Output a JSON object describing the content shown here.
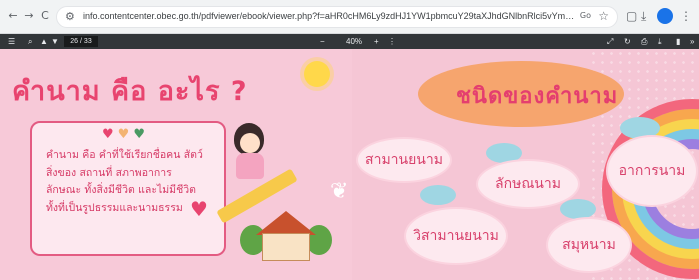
{
  "browser": {
    "back": "←",
    "forward": "→",
    "reload": "C",
    "url": "info.contentcenter.obec.go.th/pdfviewer/ebook/viewer.php?f=aHR0cHM6Ly9zdHJ1YW1pbmcuY29taXJhdGNlbnRlci5vYmVjLmdvLnRoL2NjLWFwaS9hcGkvdjEvc3RyZWFtaW5nL3AvTD...",
    "ext_label": "Go",
    "star": "☆"
  },
  "pdf_toolbar": {
    "menu_icon": "☰",
    "page_current": "26",
    "page_total": "/ 33",
    "zoom_minus": "−",
    "zoom_value": "40%",
    "zoom_plus": "+",
    "more": "⋮"
  },
  "left_page": {
    "title": "คำนาม คือ อะไร ?",
    "hearts": "♥♥♥",
    "text_lines": [
      "คำนาม คือ คำที่ใช้เรียกชื่อคน สัตว์",
      "สิ่งของ สถานที่ สภาพอาการ",
      "ลักษณะ ทั้งสิ่งมีชีวิต และไม่มีชีวิต",
      "ทั้งที่เป็นรูปธรรมและนามธรรม"
    ]
  },
  "right_page": {
    "title": "ชนิดของคำนาม",
    "types": [
      "สามานยนาม",
      "ลักษณนาม",
      "อาการนาม",
      "วิสามานยนาม",
      "สมุหนาม"
    ]
  },
  "colors": {
    "title_pink": "#e8446f",
    "page_bg": "#f7c9d8",
    "orange_pill": "#f6a56e",
    "cloud_blue": "#9fd6e3"
  }
}
